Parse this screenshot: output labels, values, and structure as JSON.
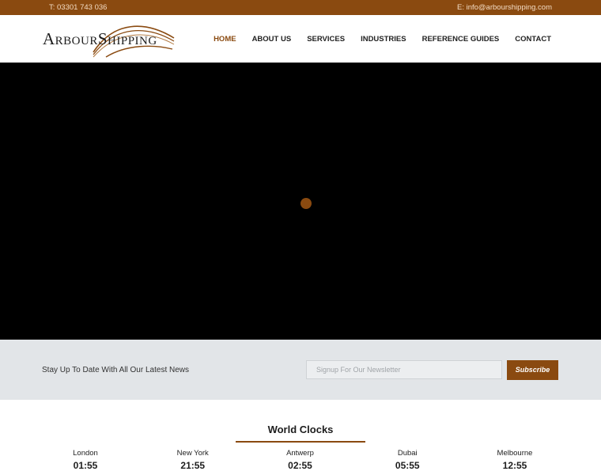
{
  "topbar": {
    "phone": "T: 03301 743 036",
    "email": "E: info@arbourshipping.com"
  },
  "header": {
    "logo_text": "ArbourShipping",
    "nav": [
      {
        "label": "HOME",
        "active": true
      },
      {
        "label": "ABOUT US",
        "active": false
      },
      {
        "label": "SERVICES",
        "active": false
      },
      {
        "label": "INDUSTRIES",
        "active": false
      },
      {
        "label": "REFERENCE GUIDES",
        "active": false
      },
      {
        "label": "CONTACT",
        "active": false
      }
    ]
  },
  "newsletter": {
    "label": "Stay Up To Date With All Our Latest News",
    "placeholder": "Signup For Our Newsletter",
    "button": "Subscribe"
  },
  "clocks": {
    "title": "World Clocks",
    "items": [
      {
        "city": "London",
        "time": "01:55"
      },
      {
        "city": "New York",
        "time": "21:55"
      },
      {
        "city": "Antwerp",
        "time": "02:55"
      },
      {
        "city": "Dubai",
        "time": "05:55"
      },
      {
        "city": "Melbourne",
        "time": "12:55"
      }
    ]
  },
  "colors": {
    "brand": "#8a4a10",
    "band": "#e2e5e8"
  }
}
